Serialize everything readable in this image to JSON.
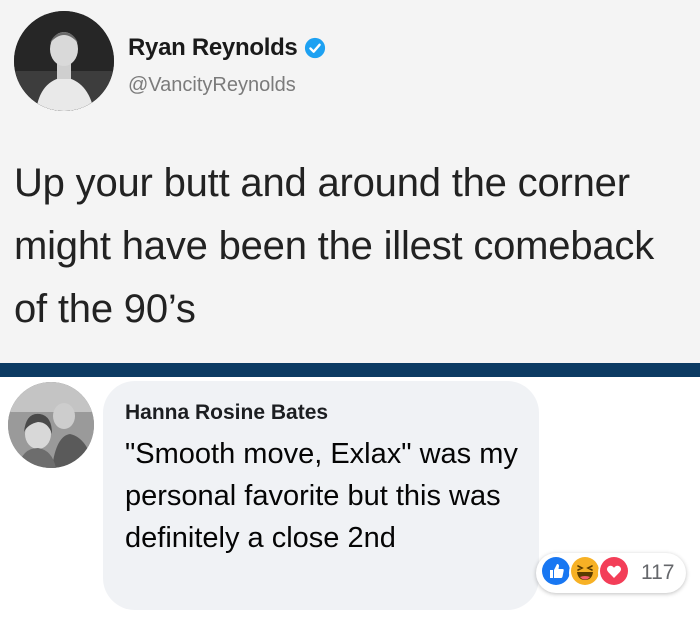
{
  "tweet": {
    "author_name": "Ryan Reynolds",
    "author_handle": "@VancityReynolds",
    "text": "Up your butt and around the corner might have been the illest comeback of the 90’s",
    "verified_icon": "verified-badge-icon"
  },
  "comment": {
    "author_name": "Hanna Rosine Bates",
    "text": "\"Smooth move, Exlax\" was my personal favorite but this was definitely a close 2nd",
    "reactions": {
      "types": [
        "like-reaction-icon",
        "haha-reaction-icon",
        "love-reaction-icon"
      ],
      "count": "117"
    }
  },
  "colors": {
    "divider": "#0c3b63",
    "verified": "#1da1f2",
    "like": "#1877f2",
    "haha": "#f7b125",
    "love": "#f33e58"
  }
}
